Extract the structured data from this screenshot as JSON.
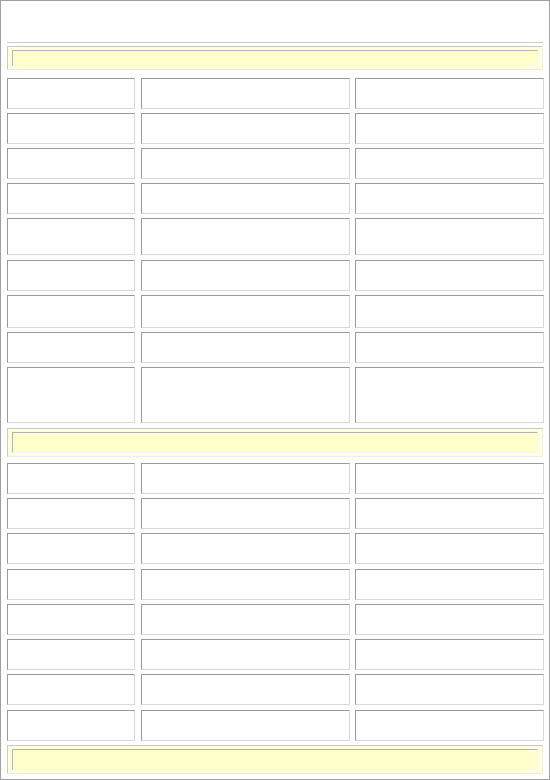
{
  "page": {
    "title": ""
  },
  "sections": [
    {
      "label": ""
    },
    {
      "label": ""
    },
    {
      "label": ""
    }
  ],
  "rows_group_1": [
    {
      "col1": "",
      "col2": "",
      "col3": ""
    },
    {
      "col1": "",
      "col2": "",
      "col3": ""
    },
    {
      "col1": "",
      "col2": "",
      "col3": ""
    },
    {
      "col1": "",
      "col2": "",
      "col3": ""
    },
    {
      "col1": "",
      "col2": "",
      "col3": ""
    },
    {
      "col1": "",
      "col2": "",
      "col3": ""
    },
    {
      "col1": "",
      "col2": "",
      "col3": ""
    },
    {
      "col1": "",
      "col2": "",
      "col3": ""
    },
    {
      "col1": "",
      "col2": "",
      "col3": ""
    }
  ],
  "rows_group_2": [
    {
      "col1": "",
      "col2": "",
      "col3": ""
    },
    {
      "col1": "",
      "col2": "",
      "col3": ""
    },
    {
      "col1": "",
      "col2": "",
      "col3": ""
    },
    {
      "col1": "",
      "col2": "",
      "col3": ""
    },
    {
      "col1": "",
      "col2": "",
      "col3": ""
    },
    {
      "col1": "",
      "col2": "",
      "col3": ""
    },
    {
      "col1": "",
      "col2": "",
      "col3": ""
    },
    {
      "col1": "",
      "col2": "",
      "col3": ""
    }
  ],
  "colors": {
    "section_band": "#ffffdd",
    "section_inner": "#ffffcc",
    "cell_border_dark": "#9a9a9a",
    "cell_border_light": "#d8d8d8",
    "frame_border": "#a0a0a0"
  }
}
